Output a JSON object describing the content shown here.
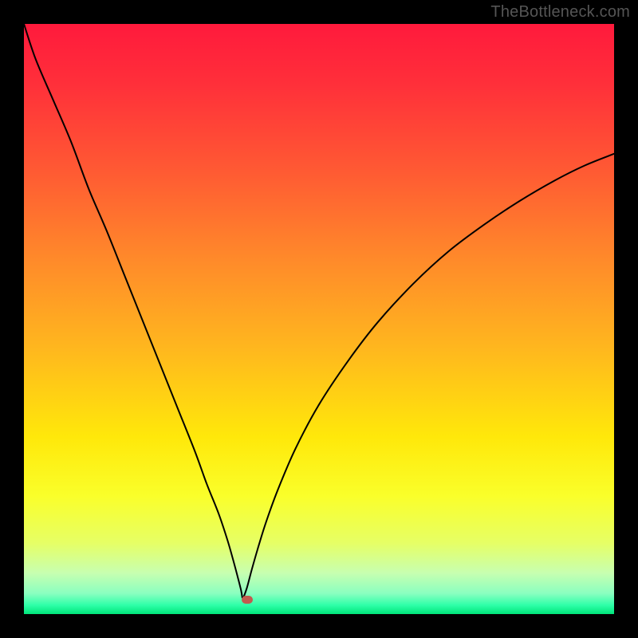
{
  "watermark": {
    "text": "TheBottleneck.com"
  },
  "colors": {
    "frame": "#000000",
    "watermark": "#5a5a5a",
    "curve": "#000000",
    "marker": "#c25b4f",
    "gradient_stops": [
      {
        "offset": 0.0,
        "color": "#ff1a3c"
      },
      {
        "offset": 0.1,
        "color": "#ff2f3a"
      },
      {
        "offset": 0.25,
        "color": "#ff5a33"
      },
      {
        "offset": 0.4,
        "color": "#ff8a2a"
      },
      {
        "offset": 0.55,
        "color": "#ffb71e"
      },
      {
        "offset": 0.7,
        "color": "#ffe80a"
      },
      {
        "offset": 0.8,
        "color": "#faff2a"
      },
      {
        "offset": 0.88,
        "color": "#e6ff66"
      },
      {
        "offset": 0.93,
        "color": "#c8ffb0"
      },
      {
        "offset": 0.965,
        "color": "#8affc0"
      },
      {
        "offset": 0.985,
        "color": "#2effa8"
      },
      {
        "offset": 1.0,
        "color": "#00e47a"
      }
    ]
  },
  "chart_data": {
    "type": "line",
    "title": "",
    "xlabel": "",
    "ylabel": "",
    "xlim": [
      0,
      100
    ],
    "ylim": [
      0,
      100
    ],
    "notch_x": 37,
    "marker": {
      "x": 37.8,
      "y": 2.5
    },
    "series": [
      {
        "name": "bottleneck-curve",
        "x": [
          0,
          2,
          5,
          8,
          11,
          14,
          17,
          20,
          23,
          26,
          29,
          31,
          33,
          34.5,
          35.5,
          36.3,
          36.8,
          37.0,
          37.2,
          37.8,
          38.6,
          39.6,
          41,
          43,
          46,
          50,
          55,
          60,
          66,
          72,
          78,
          84,
          90,
          95,
          100
        ],
        "y": [
          100,
          94,
          87,
          80,
          72,
          65,
          57.5,
          50,
          42.5,
          35,
          27.5,
          22,
          17,
          12.5,
          9,
          6,
          4,
          2.8,
          2.8,
          4.5,
          7.5,
          11,
          15.5,
          21,
          28,
          35.5,
          43,
          49.5,
          56,
          61.5,
          66,
          70,
          73.5,
          76,
          78
        ]
      }
    ]
  }
}
